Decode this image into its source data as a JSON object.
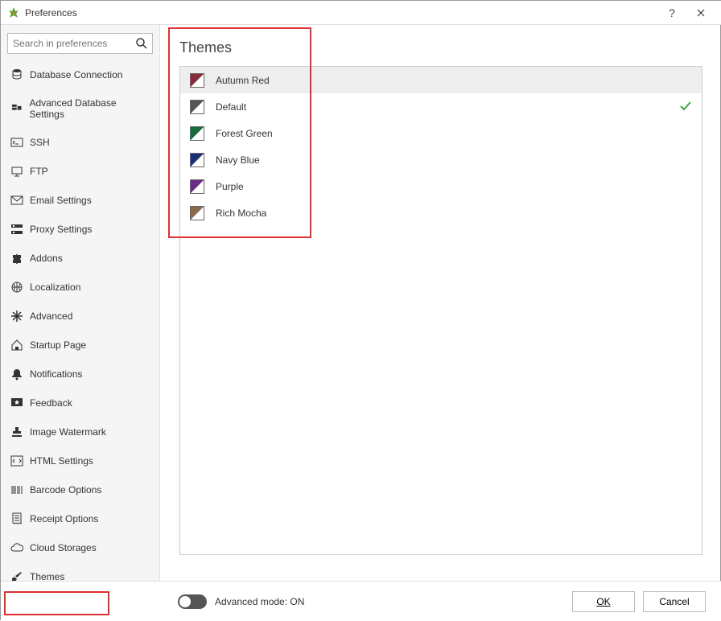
{
  "window": {
    "title": "Preferences"
  },
  "search": {
    "placeholder": "Search in preferences"
  },
  "sidebar": {
    "items": [
      {
        "label": "Database Connection",
        "icon": "database-icon"
      },
      {
        "label": "Advanced Database Settings",
        "icon": "settings-advanced-icon"
      },
      {
        "label": "SSH",
        "icon": "terminal-icon"
      },
      {
        "label": "FTP",
        "icon": "ftp-icon"
      },
      {
        "label": "Email Settings",
        "icon": "mail-icon"
      },
      {
        "label": "Proxy Settings",
        "icon": "proxy-icon"
      },
      {
        "label": "Addons",
        "icon": "puzzle-icon"
      },
      {
        "label": "Localization",
        "icon": "globe-icon"
      },
      {
        "label": "Advanced",
        "icon": "asterisk-icon"
      },
      {
        "label": "Startup Page",
        "icon": "home-icon"
      },
      {
        "label": "Notifications",
        "icon": "bell-icon"
      },
      {
        "label": "Feedback",
        "icon": "star-icon"
      },
      {
        "label": "Image Watermark",
        "icon": "stamp-icon"
      },
      {
        "label": "HTML Settings",
        "icon": "code-icon"
      },
      {
        "label": "Barcode Options",
        "icon": "barcode-icon"
      },
      {
        "label": "Receipt Options",
        "icon": "receipt-icon"
      },
      {
        "label": "Cloud Storages",
        "icon": "cloud-icon"
      },
      {
        "label": "Themes",
        "icon": "brush-icon"
      }
    ],
    "selected_index": 17
  },
  "content": {
    "title": "Themes",
    "themes": [
      {
        "name": "Autumn Red",
        "color": "#8b2a3a",
        "selected": true,
        "active": false
      },
      {
        "name": "Default",
        "color": "#555555",
        "selected": false,
        "active": true
      },
      {
        "name": "Forest Green",
        "color": "#156d3a",
        "selected": false,
        "active": false
      },
      {
        "name": "Navy Blue",
        "color": "#1a2f7a",
        "selected": false,
        "active": false
      },
      {
        "name": "Purple",
        "color": "#6a2a8a",
        "selected": false,
        "active": false
      },
      {
        "name": "Rich Mocha",
        "color": "#8a6a4a",
        "selected": false,
        "active": false
      }
    ]
  },
  "footer": {
    "advanced_mode_label": "Advanced mode: ON",
    "ok_label": "OK",
    "cancel_label": "Cancel"
  }
}
